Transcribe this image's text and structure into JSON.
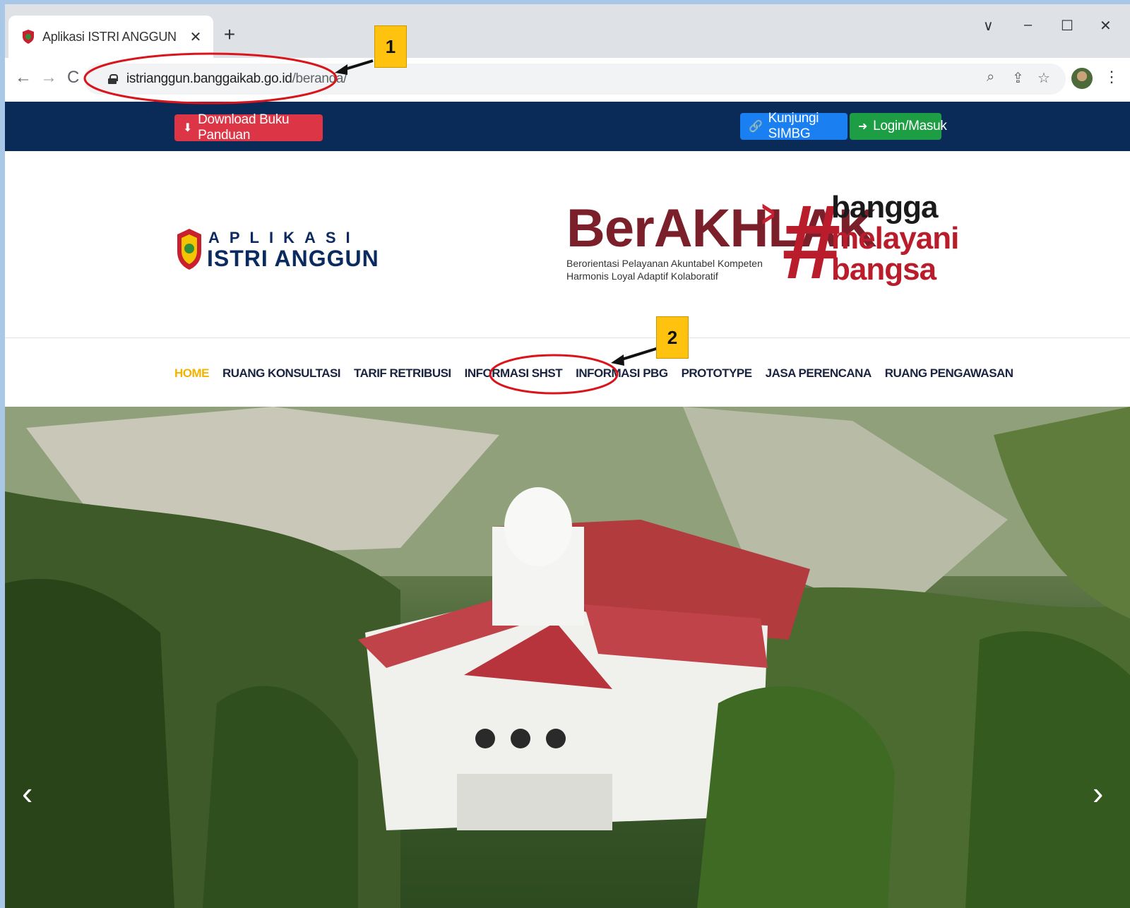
{
  "browser": {
    "tab_title": "Aplikasi ISTRI ANGGUN",
    "tab_close": "✕",
    "new_tab": "+",
    "url_host": "istrianggun.banggaikab.go.id",
    "url_path": "/beranda/",
    "window_controls": [
      "∨",
      "–",
      "☐",
      "✕"
    ]
  },
  "topbar": {
    "download_label": "Download Buku Panduan",
    "simbg_label": "Kunjungi SIMBG",
    "login_label": "Login/Masuk"
  },
  "logo": {
    "line1": "APLIKASI",
    "line2": "ISTRI ANGGUN"
  },
  "berakhlak": {
    "word": "BerAKHLAK",
    "tagline1": "Berorientasi Pelayanan Akuntabel Kompeten",
    "tagline2": "Harmonis Loyal Adaptif Kolaboratif",
    "hash": "#",
    "slogan": [
      "bangga",
      "melayani",
      "bangsa"
    ]
  },
  "nav": {
    "items": [
      "HOME",
      "RUANG KONSULTASI",
      "TARIF RETRIBUSI",
      "INFORMASI SHST",
      "INFORMASI PBG",
      "PROTOTYPE",
      "JASA PERENCANA",
      "RUANG PENGAWASAN"
    ]
  },
  "carousel": {
    "prev": "‹",
    "next": "›"
  },
  "annotations": [
    "1",
    "2"
  ],
  "colors": {
    "topbar": "#0a2a57",
    "download": "#dc3545",
    "simbg": "#1a7ff0",
    "login": "#1e9e44",
    "nav_active": "#f2b400",
    "annotation": "#ffc20e",
    "highlight": "#d9141b"
  }
}
